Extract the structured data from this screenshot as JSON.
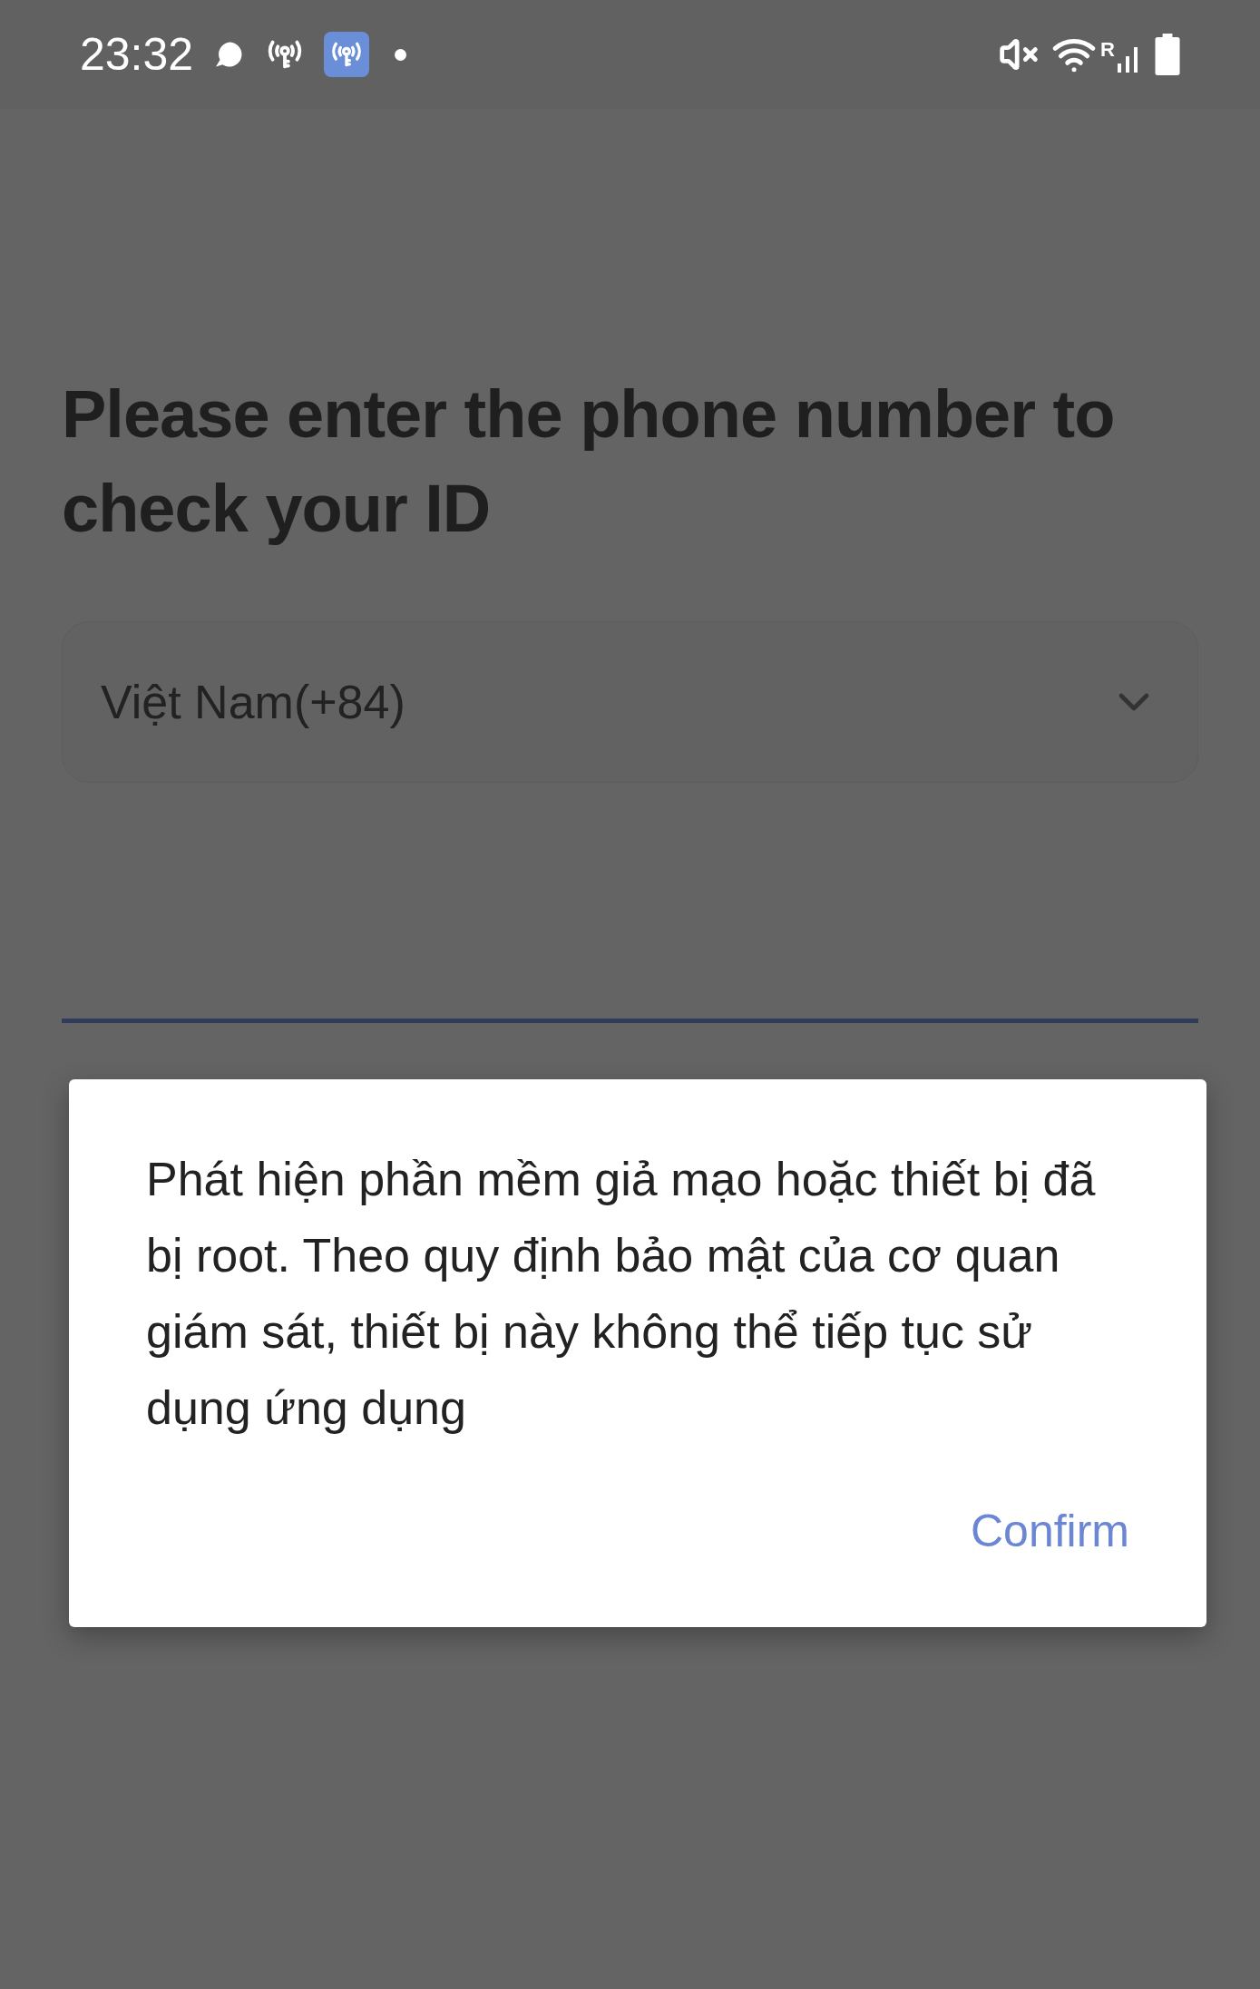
{
  "status_bar": {
    "time": "23:32",
    "roaming_label": "R"
  },
  "title": "Please enter the phone number to check your ID",
  "country_select": {
    "value": "Việt Nam(+84)",
    "expanded": false
  },
  "dialog": {
    "message": "Phát hiện phần mềm giả mạo hoặc thiết bị đã bị root. Theo quy định bảo mật của cơ quan giám sát, thiết bị này không thể tiếp tục sử dụng ứng dụng",
    "buttons": [
      "Confirm"
    ]
  }
}
